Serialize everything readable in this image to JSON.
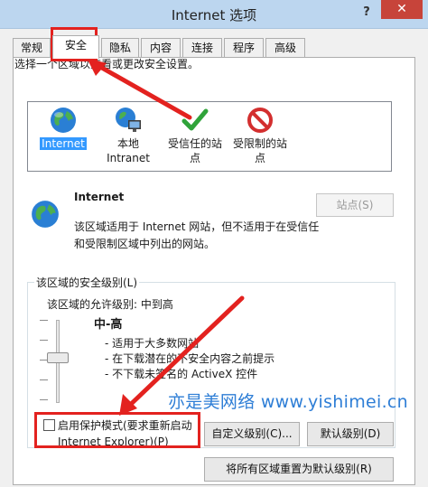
{
  "window": {
    "title": "Internet 选项",
    "help_icon": "question-mark-icon",
    "close_icon": "close-icon",
    "help_label": "?",
    "close_label": "✕"
  },
  "tabs": [
    {
      "label": "常规"
    },
    {
      "label": "安全"
    },
    {
      "label": "隐私"
    },
    {
      "label": "内容"
    },
    {
      "label": "连接"
    },
    {
      "label": "程序"
    },
    {
      "label": "高级"
    }
  ],
  "security": {
    "select_zone_label": "选择一个区域以查看或更改安全设置。",
    "zones": [
      {
        "label": "Internet",
        "icon": "globe-icon",
        "selected": true
      },
      {
        "label": "本地\nIntranet",
        "line1": "本地",
        "line2": "Intranet",
        "icon": "intranet-globe-icon"
      },
      {
        "label": "受信任的站\n点",
        "line1": "受信任的站",
        "line2": "点",
        "icon": "checkmark-icon"
      },
      {
        "label": "受限制的站\n点",
        "line1": "受限制的站",
        "line2": "点",
        "icon": "prohibited-icon"
      }
    ],
    "zone_title": "Internet",
    "zone_desc_line1": "该区域适用于 Internet 网站，但不适用于在受信任",
    "zone_desc_line2": "和受限制区域中列出的网站。",
    "sites_button": "站点(S)",
    "group_title": "该区域的安全级别(L)",
    "allowed_levels": "该区域的允许级别: 中到高",
    "level_name": "中-高",
    "level_bullets": [
      "- 适用于大多数网站",
      "- 在下载潜在的不安全内容之前提示",
      "- 不下载未签名的 ActiveX 控件"
    ],
    "protected_mode_line1": "启用保护模式(要求重新启动",
    "protected_mode_line2": "Internet Explorer)(P)",
    "protected_mode_checked": false,
    "custom_level_button": "自定义级别(C)...",
    "default_level_button": "默认级别(D)",
    "reset_all_button": "将所有区域重置为默认级别(R)"
  },
  "watermark": "亦是美网络 www.yishimei.cn",
  "colors": {
    "annotation_red": "#e3221f",
    "selection_blue": "#3399ff",
    "watermark_blue": "#2e7ed6"
  }
}
